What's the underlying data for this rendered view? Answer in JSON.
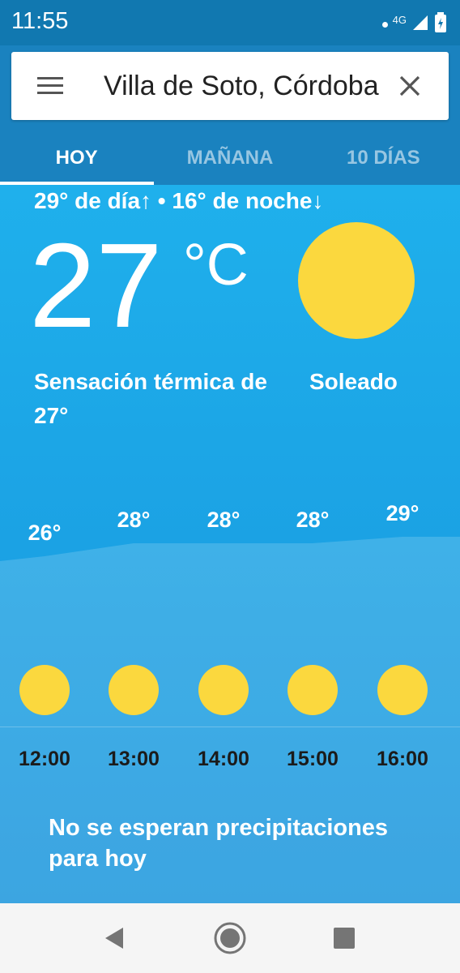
{
  "status": {
    "time": "11:55",
    "network": "4G"
  },
  "search": {
    "city": "Villa de Soto, Córdoba"
  },
  "tabs": [
    {
      "label": "HOY",
      "active": true
    },
    {
      "label": "MAÑANA",
      "active": false
    },
    {
      "label": "10 DÍAS",
      "active": false
    }
  ],
  "today": {
    "day_night": "29° de día↑ • 16° de noche↓",
    "temperature": "27",
    "unit": "°C",
    "feels_like": "Sensación térmica de 27°",
    "condition": "Soleado"
  },
  "hourly": [
    {
      "time": "12:00",
      "temp": "26°",
      "value": 26,
      "icon": "sun-icon"
    },
    {
      "time": "13:00",
      "temp": "28°",
      "value": 28,
      "icon": "sun-icon"
    },
    {
      "time": "14:00",
      "temp": "28°",
      "value": 28,
      "icon": "sun-icon"
    },
    {
      "time": "15:00",
      "temp": "28°",
      "value": 28,
      "icon": "sun-icon"
    },
    {
      "time": "16:00",
      "temp": "29°",
      "value": 29,
      "icon": "sun-icon"
    }
  ],
  "precipitation": "No se esperan precipitaciones para hoy",
  "colors": {
    "sun": "#fbd83e",
    "header": "#1a82bf",
    "main": "#1fb0ec"
  }
}
